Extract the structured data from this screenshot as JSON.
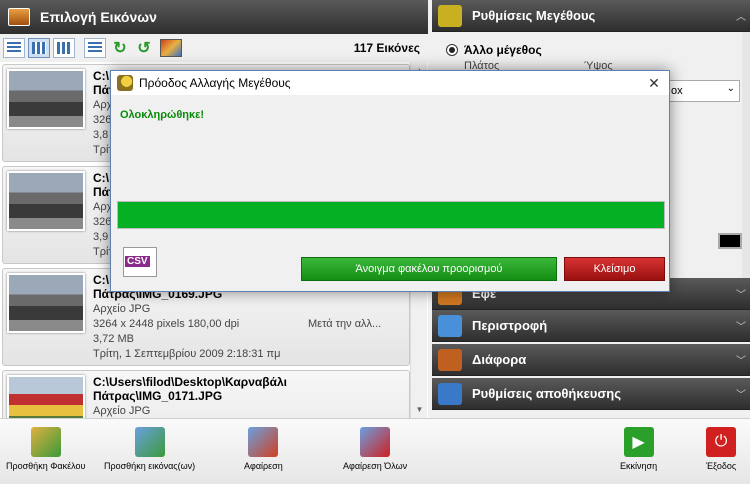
{
  "left_panel": {
    "title": "Επιλογή Εικόνων",
    "image_count": "117 Εικόνες",
    "items": [
      {
        "line1": "C:\\",
        "line2": "Πάτ",
        "line3": "Αρχ",
        "line4": "326",
        "line5": "3,8",
        "line6": "Τρίτ"
      },
      {
        "line1": "C:\\",
        "line2": "Πάτ",
        "line3": "Αρχ",
        "line4": "326",
        "line5": "3,9",
        "line6": "Τρίτ"
      },
      {
        "line1": "C:\\",
        "line2": "Πάτρας\\IMG_0169.JPG",
        "line3": "Αρχείο JPG",
        "line4": "3264 x 2448 pixels 180,00 dpi",
        "line4_right": "Μετά την αλλ...",
        "line5": "3,72 MB",
        "line6": "Τρίτη, 1 Σεπτεμβρίου 2009 2:18:31 πμ"
      },
      {
        "line1": "C:\\Users\\filod\\Desktop\\Καρναβάλι",
        "line2": "Πάτρας\\IMG_0171.JPG",
        "line3": "Αρχείο JPG",
        "line4": "",
        "line5": "",
        "line6": ""
      }
    ]
  },
  "right_panel": {
    "sections": [
      {
        "title": "Ρυθμίσεις Μεγέθους",
        "icon": "resize-icon",
        "color": "#c8b020"
      },
      {
        "title": "Εφέ",
        "icon": "effects-icon",
        "color": "#d07820"
      },
      {
        "title": "Περιστροφή",
        "icon": "rotate-icon",
        "color": "#4a90d8"
      },
      {
        "title": "Διάφορα",
        "icon": "tools-icon",
        "color": "#c06020"
      },
      {
        "title": "Ρυθμίσεις αποθήκευσης",
        "icon": "save-settings-icon",
        "color": "#3a78c8"
      }
    ],
    "other_size_label": "Άλλο μέγεθος",
    "width_label": "Πλάτος",
    "height_label": "Ύψος",
    "select_value": "ox"
  },
  "dialog": {
    "title": "Πρόοδος Αλλαγής Μεγέθους",
    "status": "Ολοκληρώθηκε!",
    "progress_percent": 100,
    "csv_label": "CSV",
    "open_folder_label": "Άνοιγμα φακέλου προορισμού",
    "close_label": "Κλείσιμο"
  },
  "bottom_toolbar": {
    "buttons": [
      {
        "label": "Προσθήκη Φακέλου",
        "icon": "add-folder-icon",
        "color": "#3a9a3a"
      },
      {
        "label": "Προσθήκη εικόνας(ων)",
        "icon": "add-image-icon",
        "color": "#3a9a3a"
      },
      {
        "label": "Αφαίρεση",
        "icon": "remove-image-icon",
        "color": "#d04020"
      },
      {
        "label": "Αφαίρεση Όλων",
        "icon": "remove-all-icon",
        "color": "#d02020"
      },
      {
        "label": "Εκκίνηση",
        "icon": "start-icon",
        "color": "#2aa02a"
      },
      {
        "label": "Έξοδος",
        "icon": "power-icon",
        "color": "#d02020"
      }
    ]
  }
}
